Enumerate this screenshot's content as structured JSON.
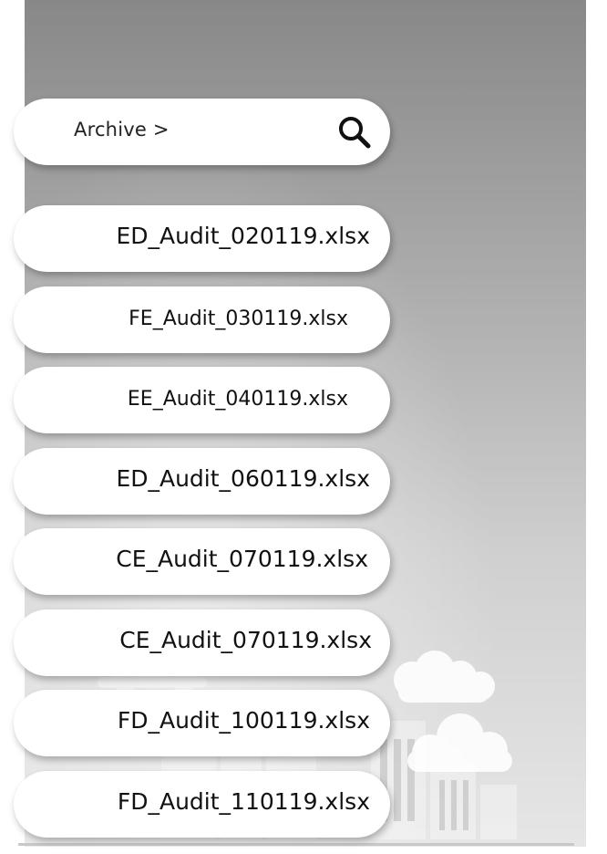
{
  "header": {
    "breadcrumb": "Archive >",
    "search_icon": "search-icon"
  },
  "files": [
    {
      "name": "ED_Audit_020119.xlsx"
    },
    {
      "name": "FE_Audit_030119.xlsx"
    },
    {
      "name": "EE_Audit_040119.xlsx"
    },
    {
      "name": "ED_Audit_060119.xlsx"
    },
    {
      "name": "CE_Audit_070119.xlsx"
    },
    {
      "name": "CE_Audit_070119.xlsx"
    },
    {
      "name": "FD_Audit_100119.xlsx"
    },
    {
      "name": "FD_Audit_110119.xlsx"
    }
  ],
  "colors": {
    "panel_top": "#888888",
    "panel_bottom": "#e6e6e6",
    "pill": "#ffffff",
    "text": "#111111"
  }
}
